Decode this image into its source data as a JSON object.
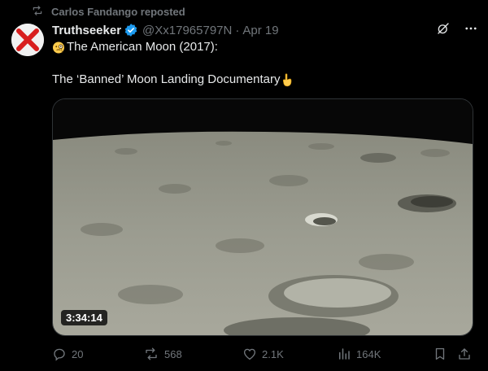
{
  "repost": {
    "label": "Carlos Fandango reposted",
    "icon": "repost-icon"
  },
  "author": {
    "name": "Truthseeker",
    "handle": "@Xx17965797N",
    "date": "Apr 19",
    "separator": "·",
    "avatar_icon": "red-x-avatar",
    "verified_color": "#1d9bf0"
  },
  "tweet": {
    "line1": "The American Moon (2017):",
    "line1_emoji": "face-with-monocle",
    "line2": "The ‘Banned’ Moon Landing Documentary",
    "line2_emoji": "backhand-index-pointing-down"
  },
  "media": {
    "type": "video",
    "duration": "3:34:14",
    "subject": "lunar surface"
  },
  "actions": {
    "replies": "20",
    "reposts": "568",
    "likes": "2.1K",
    "views": "164K",
    "icons": [
      "reply-icon",
      "repost-icon",
      "like-icon",
      "views-icon",
      "bookmark-icon",
      "share-icon"
    ]
  },
  "colors": {
    "background": "#000000",
    "text": "#e7e9ea",
    "muted": "#71767b",
    "accent": "#1d9bf0"
  }
}
